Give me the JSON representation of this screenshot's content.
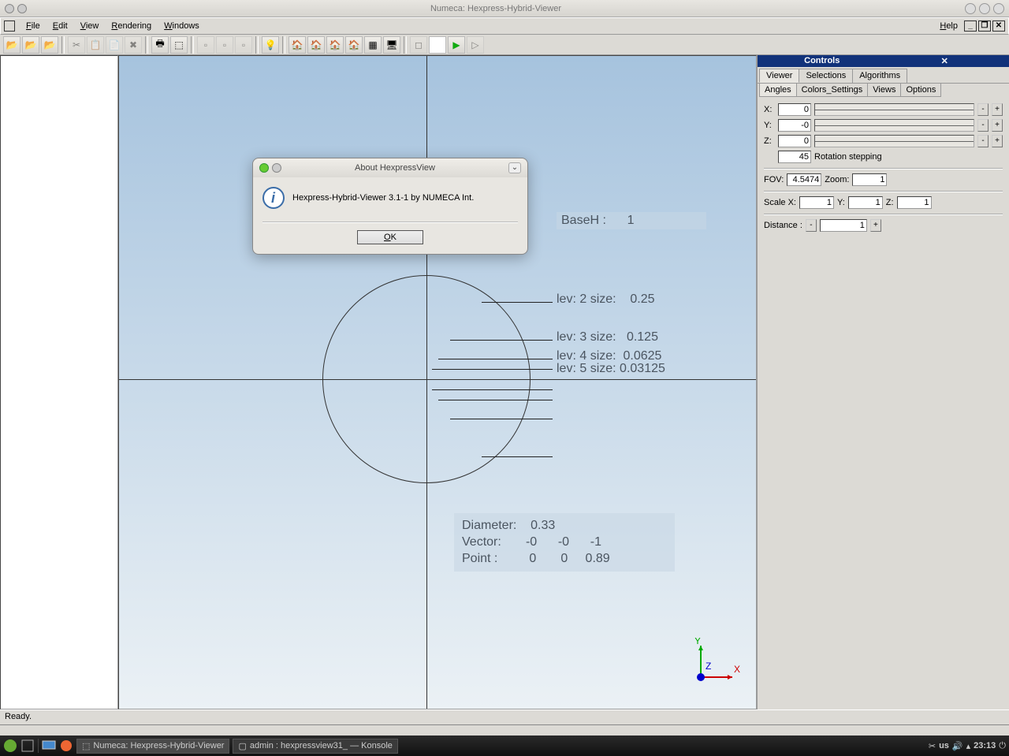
{
  "window": {
    "title": "Numeca: Hexpress-Hybrid-Viewer"
  },
  "menu": {
    "file": "File",
    "edit": "Edit",
    "view": "View",
    "rendering": "Rendering",
    "windows": "Windows",
    "help": "Help"
  },
  "viewport": {
    "baseh_label": "BaseH :",
    "baseh_value": "1",
    "levels": [
      {
        "label": "lev: 2 size:",
        "value": "0.25"
      },
      {
        "label": "lev: 3 size:",
        "value": "0.125"
      },
      {
        "label": "lev: 4 size:",
        "value": "0.0625"
      },
      {
        "label": "lev: 5 size:",
        "value": "0.03125"
      }
    ],
    "diameter_label": "Diameter:",
    "diameter_value": "0.33",
    "vector_label": "Vector:",
    "vector_values": [
      "-0",
      "-0",
      "-1"
    ],
    "point_label": "Point :",
    "point_values": [
      "0",
      "0",
      "0.89"
    ]
  },
  "controls": {
    "title": "Controls",
    "tabs": [
      "Viewer",
      "Selections",
      "Algorithms"
    ],
    "subtabs": [
      "Angles",
      "Colors_Settings",
      "Views",
      "Options"
    ],
    "angles": {
      "x_label": "X:",
      "x": "0",
      "y_label": "Y:",
      "y": "-0",
      "z_label": "Z:",
      "z": "0",
      "step": "45",
      "step_label": "Rotation stepping"
    },
    "fov_label": "FOV:",
    "fov": "4.5474",
    "zoom_label": "Zoom:",
    "zoom": "1",
    "scalex_label": "Scale X:",
    "scalex": "1",
    "scaley_label": "Y:",
    "scaley": "1",
    "scalez_label": "Z:",
    "scalez": "1",
    "distance_label": "Distance :",
    "distance": "1"
  },
  "status": {
    "text": "Ready."
  },
  "taskbar": {
    "task1": "Numeca: Hexpress-Hybrid-Viewer",
    "task2": "admin : hexpressview31_ — Konsole",
    "kb": "us",
    "time": "23:13"
  },
  "dialog": {
    "title": "About HexpressView",
    "message": "Hexpress-Hybrid-Viewer 3.1-1 by NUMECA Int.",
    "ok": "OK"
  }
}
